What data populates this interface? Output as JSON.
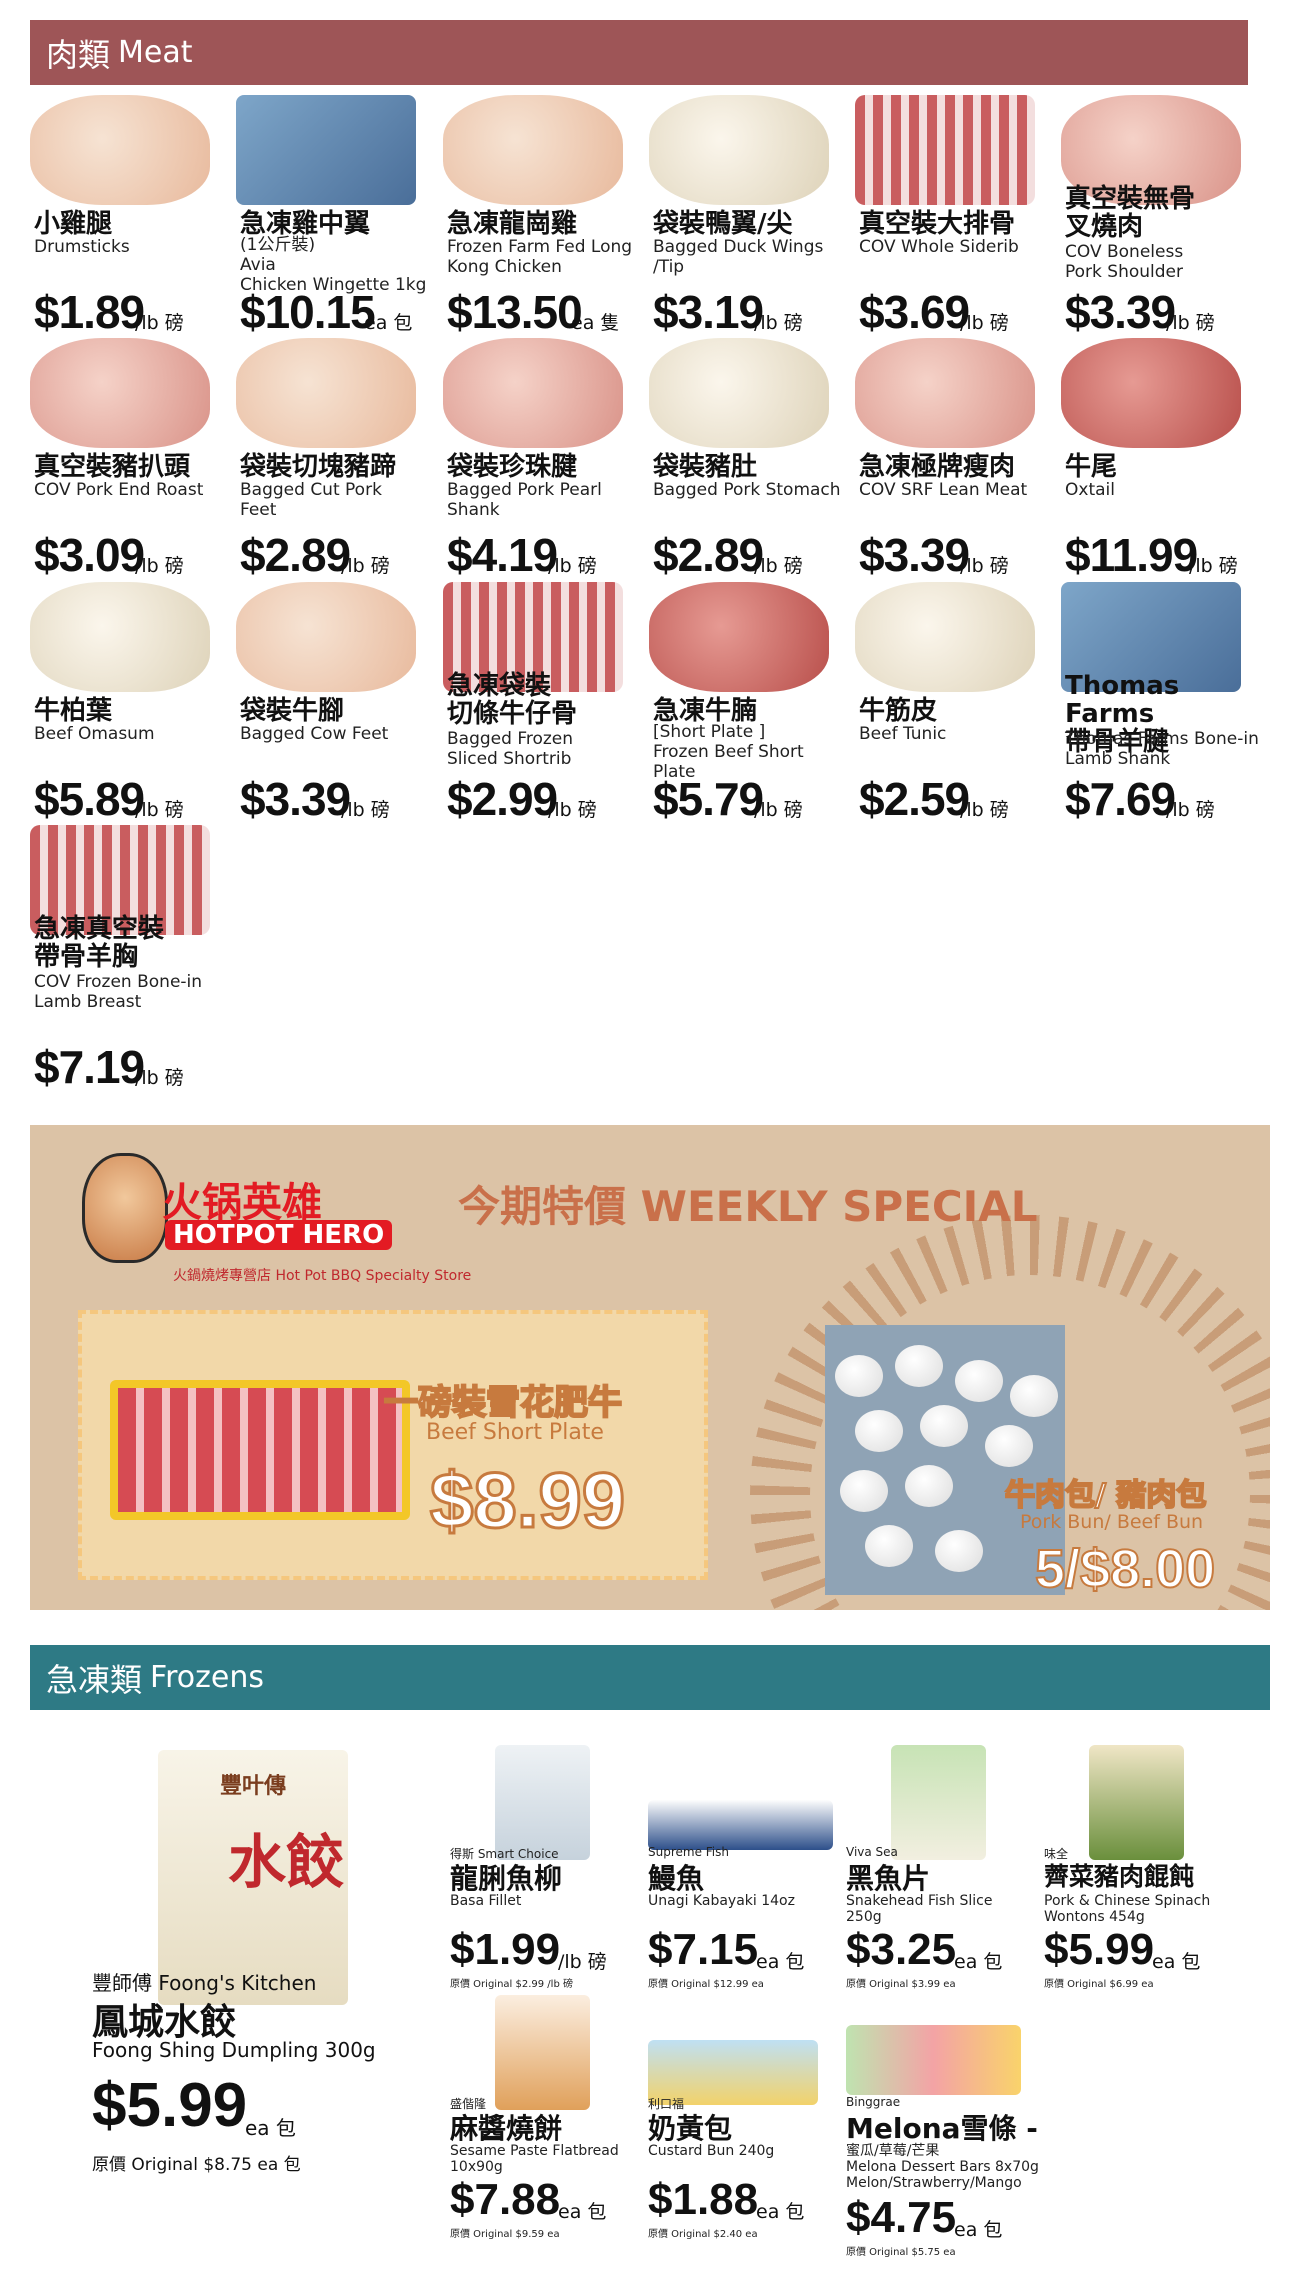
{
  "meat": {
    "header_zh": "肉類",
    "header_en": "Meat",
    "items": [
      {
        "zh": "小雞腿",
        "en": "Drumsticks",
        "price": "$1.89",
        "unit": "/lb 磅"
      },
      {
        "zh": "急凍雞中翼",
        "en": "(1公斤裝)\nAvia\nChicken Wingette 1kg",
        "price": "$10.15",
        "unit": "ea 包"
      },
      {
        "zh": "急凍龍崗雞",
        "en": "Frozen Farm Fed Long\nKong Chicken",
        "price": "$13.50",
        "unit": "ea 隻"
      },
      {
        "zh": "袋裝鴨翼/尖",
        "en": "Bagged Duck Wings\n/Tip",
        "price": "$3.19",
        "unit": "/lb 磅"
      },
      {
        "zh": "真空裝大排骨",
        "en": "COV Whole Siderib",
        "price": "$3.69",
        "unit": "/lb 磅"
      },
      {
        "zh": "真空裝無骨\n叉燒肉",
        "en": "COV Boneless\nPork Shoulder",
        "price": "$3.39",
        "unit": "/lb 磅"
      },
      {
        "zh": "真空裝豬扒頭",
        "en": "COV Pork End Roast",
        "price": "$3.09",
        "unit": "/lb 磅"
      },
      {
        "zh": "袋裝切塊豬蹄",
        "en": "Bagged Cut Pork\nFeet",
        "price": "$2.89",
        "unit": "/lb 磅"
      },
      {
        "zh": "袋裝珍珠腱",
        "en": "Bagged Pork Pearl\nShank",
        "price": "$4.19",
        "unit": "/lb 磅"
      },
      {
        "zh": "袋裝豬肚",
        "en": "Bagged Pork Stomach",
        "price": "$2.89",
        "unit": "/lb 磅"
      },
      {
        "zh": "急凍極牌瘦肉",
        "en": "COV SRF Lean Meat",
        "price": "$3.39",
        "unit": "/lb 磅"
      },
      {
        "zh": "牛尾",
        "en": "Oxtail",
        "price": "$11.99",
        "unit": "/lb 磅"
      },
      {
        "zh": "牛柏葉",
        "en": "Beef Omasum",
        "price": "$5.89",
        "unit": "/lb 磅"
      },
      {
        "zh": "袋裝牛腳",
        "en": "Bagged Cow Feet",
        "price": "$3.39",
        "unit": "/lb 磅"
      },
      {
        "zh": "急凍袋裝\n切條牛仔骨",
        "en": "Bagged Frozen\nSliced Shortrib",
        "price": "$2.99",
        "unit": "/lb 磅"
      },
      {
        "zh": "急凍牛腩",
        "en": "[Short Plate ]\nFrozen Beef Short\nPlate",
        "price": "$5.79",
        "unit": "/lb 磅"
      },
      {
        "zh": "牛筋皮",
        "en": "Beef Tunic",
        "price": "$2.59",
        "unit": "/lb 磅"
      },
      {
        "zh": "Thomas Farms\n帶骨羊腱",
        "en": "Thomas Farms Bone-in\nLamb Shank",
        "price": "$7.69",
        "unit": "/lb 磅"
      },
      {
        "zh": "急凍真空裝\n帶骨羊胸",
        "en": "COV Frozen Bone-in\nLamb Breast",
        "price": "$7.19",
        "unit": "/lb 磅"
      }
    ]
  },
  "weekly": {
    "logo_title": "火锅英雄",
    "logo_en": "HOTPOT HERO",
    "logo_sub": "火鍋燒烤專營店 Hot Pot BBQ Specialty Store",
    "title": "今期特價 WEEKLY SPECIAL",
    "special1_zh": "一磅裝雪花肥牛",
    "special1_en": "Beef Short Plate",
    "special1_price": "$8.99",
    "special2_zh": "牛肉包/ 豬肉包",
    "special2_en": "Pork Bun/ Beef Bun",
    "special2_price": "5/$8.00"
  },
  "frozen": {
    "header_zh": "急凍類",
    "header_en": "Frozens",
    "feature": {
      "bag_brand": "豐叶傳",
      "bag_text": "水餃",
      "brand": "豐師傅 Foong's Kitchen",
      "zh": "鳳城水餃",
      "en": "Foong Shing Dumpling 300g",
      "price": "$5.99",
      "unit": "ea 包",
      "orig": "原價 Original $8.75 ea 包"
    },
    "items": [
      {
        "brand": "得斯 Smart Choice",
        "zh": "龍脷魚柳",
        "en": "Basa Fillet",
        "price": "$1.99",
        "unit": "/lb 磅",
        "orig": "原價 Original $2.99 /lb 磅"
      },
      {
        "brand": "Supreme Fish",
        "zh": "鰻魚",
        "en": "Unagi Kabayaki 14oz",
        "price": "$7.15",
        "unit": "ea 包",
        "orig": "原價 Original $12.99 ea"
      },
      {
        "brand": "Viva Sea",
        "zh": "黑魚片",
        "en": "Snakehead Fish Slice\n250g",
        "price": "$3.25",
        "unit": "ea 包",
        "orig": "原價 Original $3.99 ea"
      },
      {
        "brand": "味全",
        "zh": "薺菜豬肉餛飩",
        "en": "Pork & Chinese Spinach\nWontons 454g",
        "price": "$5.99",
        "unit": "ea 包",
        "orig": "原價 Original $6.99 ea"
      },
      {
        "brand": "盛偕隆",
        "zh": "麻醬燒餅",
        "en": "Sesame Paste Flatbread\n10x90g",
        "price": "$7.88",
        "unit": "ea 包",
        "orig": "原價 Original $9.59 ea"
      },
      {
        "brand": "利口福",
        "zh": "奶黃包",
        "en": "Custard Bun 240g",
        "price": "$1.88",
        "unit": "ea 包",
        "orig": "原價 Original $2.40 ea"
      },
      {
        "brand": "Binggrae",
        "zh": "Melona雪條 -",
        "en": "蜜瓜/草莓/芒果\nMelona Dessert Bars 8x70g\nMelon/Strawberry/Mango",
        "price": "$4.75",
        "unit": "ea 包",
        "orig": "原價 Original $5.75 ea"
      }
    ]
  },
  "colors": {
    "meat_header": "#9e5557",
    "frozen_header": "#2e7a85",
    "weekly_bg": "#dcc3a6",
    "hotpot_red": "#e31b23"
  }
}
